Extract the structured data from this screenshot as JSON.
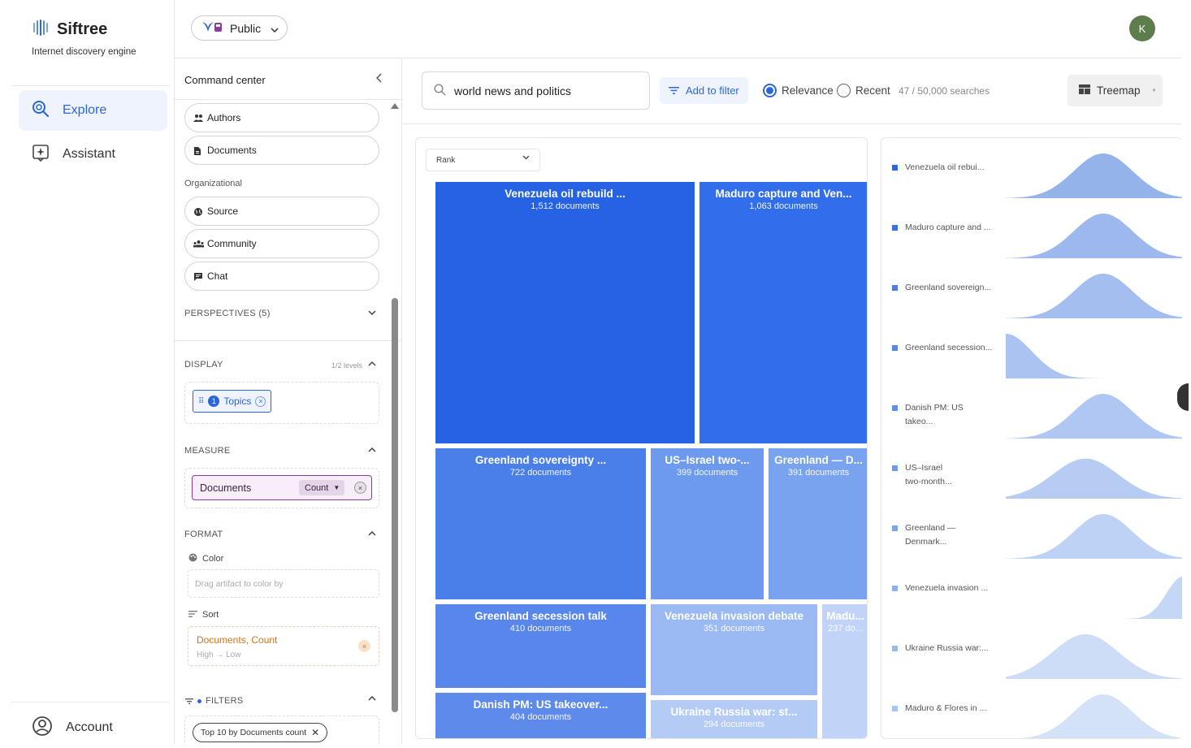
{
  "app": {
    "name": "Siftree",
    "subtitle": "Internet discovery engine"
  },
  "nav": {
    "items": [
      {
        "label": "Explore",
        "icon": "explore-search-icon",
        "active": true
      },
      {
        "label": "Assistant",
        "icon": "assistant-sparkle-icon",
        "active": false
      }
    ],
    "account_label": "Account"
  },
  "topbar": {
    "visibility_label": "Public",
    "avatar_initial": "K"
  },
  "command_center": {
    "title": "Command center",
    "pills_top": [
      {
        "label": "Authors",
        "icon": "people-icon"
      },
      {
        "label": "Documents",
        "icon": "document-icon"
      }
    ],
    "organizational_label": "Organizational",
    "pills_org": [
      {
        "label": "Source",
        "icon": "globe-icon"
      },
      {
        "label": "Community",
        "icon": "group-icon"
      },
      {
        "label": "Chat",
        "icon": "chat-icon"
      }
    ],
    "perspectives_label": "PERSPECTIVES (5)",
    "display": {
      "label": "DISPLAY",
      "levels": "1/2 levels",
      "chip_number": "1",
      "chip_label": "Topics"
    },
    "measure": {
      "label": "MEASURE",
      "chip_label": "Documents",
      "agg_label": "Count"
    },
    "format": {
      "label": "FORMAT",
      "color_label": "Color",
      "color_placeholder": "Drag artifact to color by",
      "sort_label": "Sort",
      "sort_value": "Documents, Count",
      "sort_direction": "High → Low"
    },
    "filters": {
      "label": "FILTERS",
      "chip_label": "Top 10 by Documents count"
    }
  },
  "toolbar": {
    "search_value": "world news and politics",
    "add_filter_label": "Add to filter",
    "sort_options": [
      {
        "label": "Relevance",
        "selected": true
      },
      {
        "label": "Recent",
        "selected": false
      }
    ],
    "search_count": "47 / 50,000 searches",
    "view_label": "Treemap"
  },
  "treemap": {
    "rank_select_label": "Rank",
    "tiles": [
      {
        "title": "Venezuela oil rebuild ...",
        "subtitle": "1,512 documents"
      },
      {
        "title": "Maduro capture and Ven...",
        "subtitle": "1,063 documents"
      },
      {
        "title": "Greenland sovereignty ...",
        "subtitle": "722 documents"
      },
      {
        "title": "US–Israel two-...",
        "subtitle": "399 documents"
      },
      {
        "title": "Greenland — D...",
        "subtitle": "391 documents"
      },
      {
        "title": "Greenland secession talk",
        "subtitle": "410 documents"
      },
      {
        "title": "Venezuela invasion debate",
        "subtitle": "351 documents"
      },
      {
        "title": "Madu...",
        "subtitle": "237 do..."
      },
      {
        "title": "Danish PM: US takeover...",
        "subtitle": "404 documents"
      },
      {
        "title": "Ukraine Russia war: st...",
        "subtitle": "294 documents"
      }
    ]
  },
  "chart_data": {
    "type": "table",
    "title": "",
    "categories": [
      "Venezuela oil rebuild ...",
      "Maduro capture and Ven...",
      "Greenland sovereignty ...",
      "Greenland secession talk",
      "Danish PM: US takeover...",
      "US–Israel two-...",
      "Greenland — D...",
      "Venezuela invasion debate",
      "Ukraine Russia war: st...",
      "Madu..."
    ],
    "values": [
      1512,
      1063,
      722,
      410,
      404,
      399,
      391,
      351,
      294,
      237
    ],
    "unit": "documents"
  },
  "sparklines": {
    "items": [
      {
        "label": "Venezuela oil rebui...",
        "color": "#2b67d8",
        "peak": 0.55,
        "width": 0.9,
        "height": 0.95
      },
      {
        "label": "Maduro capture and ...",
        "color": "#3a71de",
        "peak": 0.55,
        "width": 0.9,
        "height": 0.95
      },
      {
        "label": "Greenland sovereign...",
        "color": "#4a7de2",
        "peak": 0.55,
        "width": 0.9,
        "height": 0.95
      },
      {
        "label": "Greenland secession...",
        "color": "#5587e4",
        "peak": 0.0,
        "width": 0.8,
        "height": 0.95
      },
      {
        "label": "Danish PM: US takeo...",
        "color": "#5f8fe6",
        "peak": 0.55,
        "width": 0.9,
        "height": 0.95
      },
      {
        "label": "US–Israel\ntwo-month...",
        "color": "#6e9ae8",
        "peak": 0.45,
        "width": 1.0,
        "height": 0.85
      },
      {
        "label": "Greenland —\nDenmark...",
        "color": "#7da5eb",
        "peak": 0.55,
        "width": 0.9,
        "height": 0.95
      },
      {
        "label": "Venezuela invasion ...",
        "color": "#8cb0ed",
        "peak": 1.0,
        "width": 0.5,
        "height": 0.9
      },
      {
        "label": "Ukraine Russia war:...",
        "color": "#9bbbef",
        "peak": 0.45,
        "width": 1.0,
        "height": 0.95
      },
      {
        "label": "Maduro & Flores in ...",
        "color": "#a9c5f2",
        "peak": 0.55,
        "width": 0.9,
        "height": 0.95
      }
    ]
  }
}
